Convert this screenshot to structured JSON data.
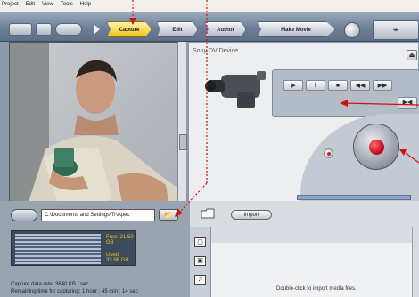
{
  "menu": [
    "Project",
    "Edit",
    "View",
    "Tools",
    "Help"
  ],
  "toolbar": {
    "steps": [
      "Capture",
      "Edit",
      "Author",
      "Make Movie"
    ],
    "active_step": "Capture"
  },
  "device": {
    "title": "Sony DV Device",
    "transport_buttons": [
      "▶",
      "‖",
      "■",
      "◀◀",
      "▶▶"
    ],
    "edge_button": "▶◀"
  },
  "capture": {
    "path": "C:\\Documents and Settings\\Tr\\Apec",
    "meter_free": "Free: 21.50 GB",
    "meter_used": "Used: 33.96 GB",
    "rate": "Capture data rate: 3640 KB / sec",
    "remaining": "Remaining time for capturing: 1 hour : 45 min : 14 sec"
  },
  "album": {
    "import_label": "Import",
    "hint": "Double-click to import media files."
  },
  "colors": {
    "accent_active": "#f1c21c",
    "record_red": "#c0001a",
    "annotation_red": "#d21010"
  }
}
